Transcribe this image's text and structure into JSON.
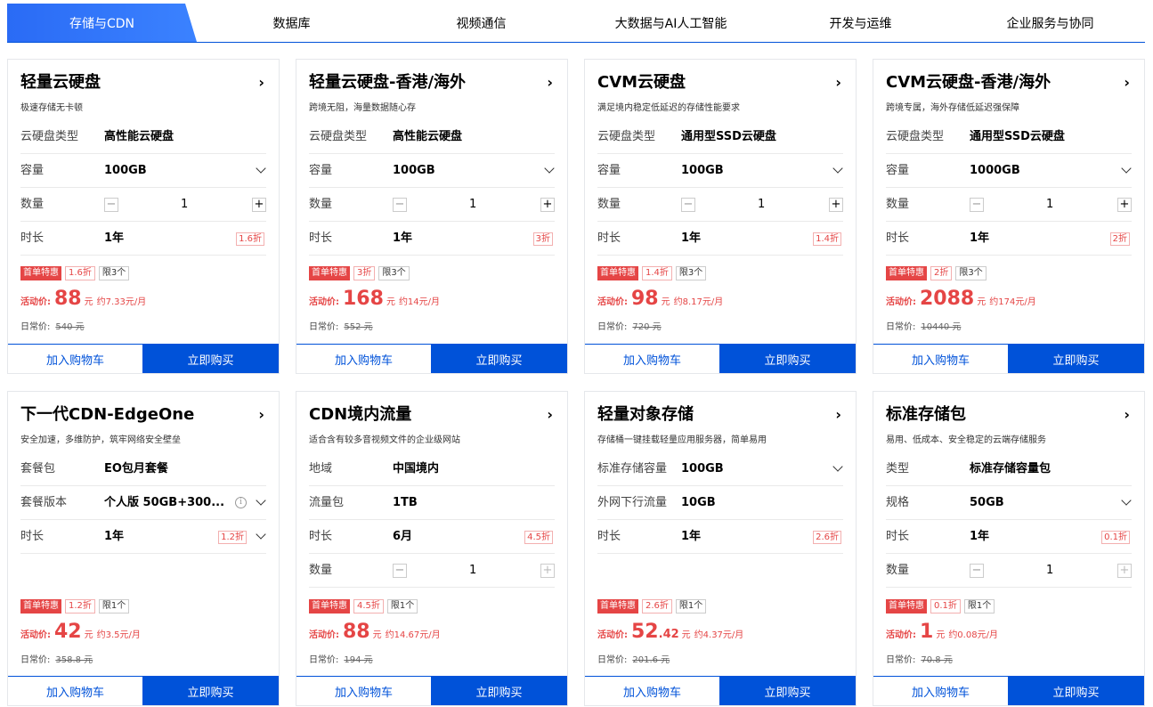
{
  "tabs": [
    "存储与CDN",
    "数据库",
    "视频通信",
    "大数据与AI人工智能",
    "开发与运维",
    "企业服务与协同"
  ],
  "active_tab": 0,
  "common": {
    "tag_first": "首单特惠",
    "price_label": "活动价:",
    "orig_label": "日常价:",
    "yuan": "元",
    "cart": "加入购物车",
    "buy": "立即购买",
    "minus": "−",
    "plus": "+"
  },
  "cards": [
    {
      "title": "轻量云硬盘",
      "subtitle": "极速存储无卡顿",
      "rows": {
        "r1": {
          "label": "云硬盘类型",
          "value": "高性能云硬盘"
        },
        "r2": {
          "label": "容量",
          "value": "100GB"
        },
        "r3": {
          "label": "数量",
          "value": "1"
        },
        "r4": {
          "label": "时长",
          "value": "1年",
          "discount": "1.6折"
        }
      },
      "tag_discount": "1.6折",
      "tag_limit": "限3个",
      "price": "88",
      "price_decimal": "",
      "per_month": "约7.33元/月",
      "orig": "540 元"
    },
    {
      "title": "轻量云硬盘-香港/海外",
      "subtitle": "跨境无阻，海量数据随心存",
      "rows": {
        "r1": {
          "label": "云硬盘类型",
          "value": "高性能云硬盘"
        },
        "r2": {
          "label": "容量",
          "value": "100GB"
        },
        "r3": {
          "label": "数量",
          "value": "1"
        },
        "r4": {
          "label": "时长",
          "value": "1年",
          "discount": "3折"
        }
      },
      "tag_discount": "3折",
      "tag_limit": "限3个",
      "price": "168",
      "price_decimal": "",
      "per_month": "约14元/月",
      "orig": "552 元"
    },
    {
      "title": "CVM云硬盘",
      "subtitle": "满足境内稳定低延迟的存储性能要求",
      "rows": {
        "r1": {
          "label": "云硬盘类型",
          "value": "通用型SSD云硬盘"
        },
        "r2": {
          "label": "容量",
          "value": "100GB"
        },
        "r3": {
          "label": "数量",
          "value": "1"
        },
        "r4": {
          "label": "时长",
          "value": "1年",
          "discount": "1.4折"
        }
      },
      "tag_discount": "1.4折",
      "tag_limit": "限3个",
      "price": "98",
      "price_decimal": "",
      "per_month": "约8.17元/月",
      "orig": "720 元"
    },
    {
      "title": "CVM云硬盘-香港/海外",
      "subtitle": "跨境专属，海外存储低延迟强保障",
      "rows": {
        "r1": {
          "label": "云硬盘类型",
          "value": "通用型SSD云硬盘"
        },
        "r2": {
          "label": "容量",
          "value": "1000GB"
        },
        "r3": {
          "label": "数量",
          "value": "1"
        },
        "r4": {
          "label": "时长",
          "value": "1年",
          "discount": "2折"
        }
      },
      "tag_discount": "2折",
      "tag_limit": "限3个",
      "price": "2088",
      "price_decimal": "",
      "per_month": "约174元/月",
      "orig": "10440 元"
    },
    {
      "title": "下一代CDN-EdgeOne",
      "subtitle": "安全加速，多维防护，筑牢网络安全壁垒",
      "rows": {
        "r1": {
          "label": "套餐包",
          "value": "EO包月套餐"
        },
        "r2": {
          "label": "套餐版本",
          "value": "个人版 50GB+300..."
        },
        "r3": {
          "label": "时长",
          "value": "1年",
          "discount": "1.2折"
        }
      },
      "tag_discount": "1.2折",
      "tag_limit": "限1个",
      "price": "42",
      "price_decimal": "",
      "per_month": "约3.5元/月",
      "orig": "358.8 元"
    },
    {
      "title": "CDN境内流量",
      "subtitle": "适合含有较多音视频文件的企业级网站",
      "rows": {
        "r1": {
          "label": "地域",
          "value": "中国境内"
        },
        "r2": {
          "label": "流量包",
          "value": "1TB"
        },
        "r3": {
          "label": "时长",
          "value": "6月",
          "discount": "4.5折"
        },
        "r4": {
          "label": "数量",
          "value": "1"
        }
      },
      "tag_discount": "4.5折",
      "tag_limit": "限1个",
      "price": "88",
      "price_decimal": "",
      "per_month": "约14.67元/月",
      "orig": "194 元"
    },
    {
      "title": "轻量对象存储",
      "subtitle": "存储桶一键挂载轻量应用服务器，简单易用",
      "rows": {
        "r1": {
          "label": "标准存储容量",
          "value": "100GB"
        },
        "r2": {
          "label": "外网下行流量",
          "value": "10GB"
        },
        "r3": {
          "label": "时长",
          "value": "1年",
          "discount": "2.6折"
        }
      },
      "tag_discount": "2.6折",
      "tag_limit": "限1个",
      "price": "52",
      "price_decimal": ".42",
      "per_month": "约4.37元/月",
      "orig": "201.6 元"
    },
    {
      "title": "标准存储包",
      "subtitle": "易用、低成本、安全稳定的云端存储服务",
      "rows": {
        "r1": {
          "label": "类型",
          "value": "标准存储容量包"
        },
        "r2": {
          "label": "规格",
          "value": "50GB"
        },
        "r3": {
          "label": "时长",
          "value": "1年",
          "discount": "0.1折"
        },
        "r4": {
          "label": "数量",
          "value": "1"
        }
      },
      "tag_discount": "0.1折",
      "tag_limit": "限1个",
      "price": "1",
      "price_decimal": "",
      "per_month": "约0.08元/月",
      "orig": "70.8 元"
    }
  ]
}
